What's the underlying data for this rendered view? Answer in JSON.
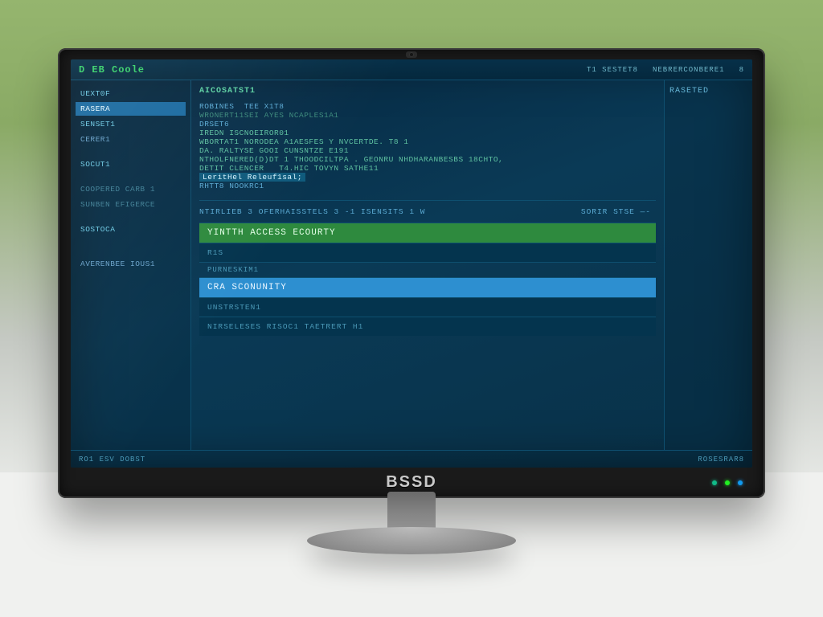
{
  "monitor_brand": "BSSD",
  "titlebar": {
    "logo": "D EB Coole",
    "meta1": "T1  SESTET8",
    "meta2": "NEBRERCONBERE1",
    "meta3": "8"
  },
  "sidebar": {
    "items": [
      {
        "label": "UEXT0F",
        "selected": false
      },
      {
        "label": "RASERA",
        "selected": true
      },
      {
        "label": "SENSET1",
        "selected": false
      },
      {
        "label": "CERER1",
        "selected": false
      },
      {
        "label": "SOCUT1",
        "selected": false
      },
      {
        "label": "COOPERED CARB 1",
        "selected": false
      },
      {
        "label": "SUNBEN EFIGERCE",
        "selected": false
      },
      {
        "label": "SOSTOCA",
        "selected": false
      },
      {
        "label": "AVERENBEE IOUS1",
        "selected": false
      }
    ]
  },
  "main": {
    "heading": "AICOSATST1",
    "lines": [
      "ROBINES  TEE X1T8",
      "WRONERT11SEI AYES NCAPLES1A1",
      "DRSET6",
      "IREDN ISCNOEIROR01",
      "",
      "WBORTAT1 NORODEA A1AESFES Y NVCERTDE. T8 1",
      "DA. RALTYSE GOOI CUNSNTZE E191",
      "NTHOLFNERED(D)DT 1 THOODCILTPA . GEONRU NHDHARANBESBS 18CHTO,",
      "DETIT CLENCER   T4.HIC TOVYN SATHE11"
    ],
    "highlight": "LeritHel Releuf1sal;",
    "postline": "RHTT8 NOOKRC1",
    "status_left": "NTIRLIEB 3 OFERHAISSTELS 3 -1  ISENSITS  1   W",
    "status_right": "SORIR STSE  —-",
    "panel": {
      "row1": "YINTTH ACCESS ECOURTY",
      "row1_sub": "R1S",
      "row2_pre": "PURNESKIM1",
      "row2": "CRA SCONUNITY",
      "row3": "UNSTRSTEN1",
      "row4": "NIRSELESES RISOC1 TAETRERT H1"
    }
  },
  "rightcol": {
    "heading": "RASETED"
  },
  "footer": {
    "left": "RO1 ESV DOBST",
    "right": "ROSESRAR8"
  }
}
